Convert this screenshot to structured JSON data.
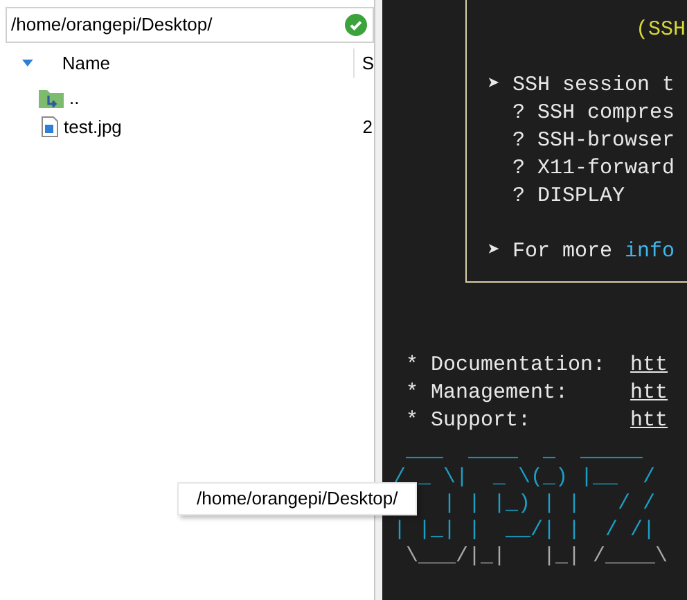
{
  "path_field": {
    "value": "/home/orangepi/Desktop/"
  },
  "file_list": {
    "columns": [
      "Name",
      "S"
    ],
    "rows": [
      {
        "kind": "parent",
        "name": "..",
        "size": ""
      },
      {
        "kind": "image",
        "name": "test.jpg",
        "size": "2"
      }
    ]
  },
  "tooltip": "/home/orangepi/Desktop/",
  "terminal": {
    "banner_title": "(SSH",
    "banner_lines": [
      {
        "kind": "bullet",
        "text": "➤ SSH session t"
      },
      {
        "kind": "plain",
        "text": "  ? SSH compres"
      },
      {
        "kind": "plain",
        "text": "  ? SSH-browser"
      },
      {
        "kind": "plain",
        "text": "  ? X11-forward"
      },
      {
        "kind": "plain",
        "text": "  ? DISPLAY"
      },
      {
        "kind": "blank"
      },
      {
        "kind": "more",
        "text": "➤ For more ",
        "link": "info"
      }
    ],
    "links": [
      {
        "label": " * Documentation:  ",
        "url": "htt"
      },
      {
        "label": " * Management:     ",
        "url": "htt"
      },
      {
        "label": " * Support:        ",
        "url": "htt"
      }
    ],
    "art": [
      " ___  ____  _  _____",
      "/ _ \\|  _ \\(_) |__  /",
      "    | | |_) | |   / /",
      "| |_| |  __/| |  / /|",
      " \\___/|_|   |_| /____\\"
    ]
  }
}
